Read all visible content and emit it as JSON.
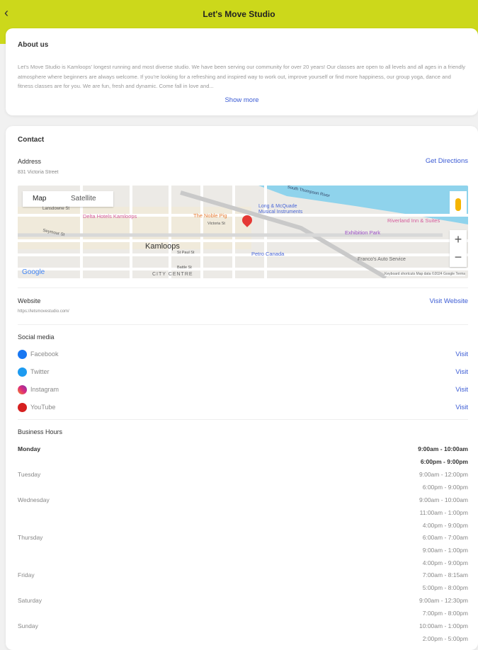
{
  "header": {
    "title": "Let's Move Studio",
    "back_icon": "chevron-left-icon"
  },
  "about": {
    "heading": "About us",
    "text": "Let's Move Studio is Kamloops' longest running and most diverse studio. We have been serving our community for over 20 years! Our classes are open to all levels and all ages in a friendly atmosphere where beginners are always welcome. If you're looking for a refreshing and inspired way to work out, improve yourself or find more happiness, our group yoga, dance and fitness classes are for you. We are fun, fresh and dynamic. Come fall in love and...",
    "show_more": "Show more"
  },
  "contact": {
    "heading": "Contact",
    "address_label": "Address",
    "address": "831 Victoria Street",
    "directions": "Get Directions",
    "map": {
      "tab_map": "Map",
      "tab_satellite": "Satellite",
      "labels": [
        "Kamloops",
        "CITY CENTRE",
        "South Thompson River",
        "Long & McQuade Musical Instruments",
        "The Noble Pig",
        "Delta Hotels Kamloops",
        "Exhibition Park",
        "Riverland Inn & Suites",
        "Petro Canada",
        "Franco's Auto Service",
        "Victoria St",
        "Lansdowne St",
        "Seymour St",
        "St Paul St",
        "Battle St"
      ],
      "zoom_in": "+",
      "zoom_out": "−",
      "google": "Google",
      "footer": "Keyboard shortcuts   Map data ©2024 Google   Terms"
    },
    "website_label": "Website",
    "website_url": "https://letsmovestudio.com/",
    "visit_website": "Visit Website"
  },
  "social": {
    "heading": "Social media",
    "items": [
      {
        "name": "Facebook",
        "action": "Visit",
        "color": "#1877f2"
      },
      {
        "name": "Twitter",
        "action": "Visit",
        "color": "#1d9bf0"
      },
      {
        "name": "Instagram",
        "action": "Visit",
        "color": "#e1306c"
      },
      {
        "name": "YouTube",
        "action": "Visit",
        "color": "#d62020"
      }
    ]
  },
  "hours": {
    "heading": "Business Hours",
    "days": [
      {
        "day": "Monday",
        "times": [
          "9:00am - 10:00am",
          "6:00pm - 9:00pm"
        ]
      },
      {
        "day": "Tuesday",
        "times": [
          "9:00am - 12:00pm",
          "6:00pm - 9:00pm"
        ]
      },
      {
        "day": "Wednesday",
        "times": [
          "9:00am - 10:00am",
          "11:00am - 1:00pm",
          "4:00pm - 9:00pm"
        ]
      },
      {
        "day": "Thursday",
        "times": [
          "6:00am - 7:00am",
          "9:00am - 1:00pm",
          "4:00pm - 9:00pm"
        ]
      },
      {
        "day": "Friday",
        "times": [
          "7:00am - 8:15am",
          "5:00pm - 8:00pm"
        ]
      },
      {
        "day": "Saturday",
        "times": [
          "9:00am - 12:30pm",
          "7:00pm - 8:00pm"
        ]
      },
      {
        "day": "Sunday",
        "times": [
          "10:00am - 1:00pm",
          "2:00pm - 5:00pm"
        ]
      }
    ]
  }
}
